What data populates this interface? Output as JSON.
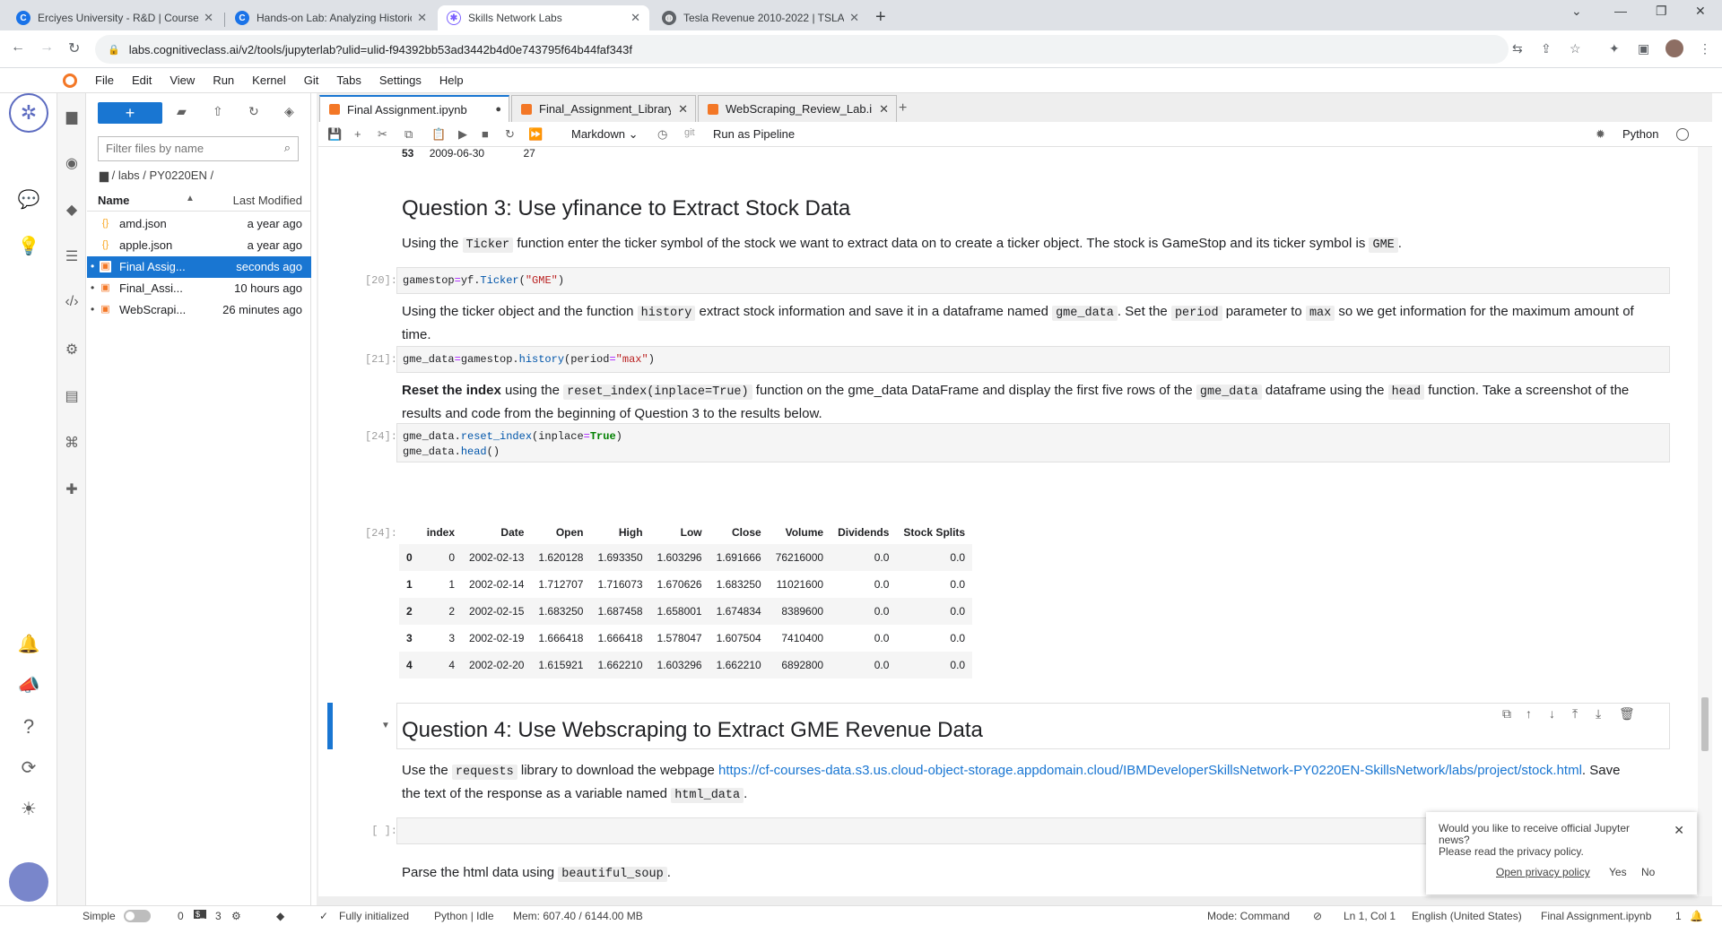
{
  "browser": {
    "tabs": [
      {
        "title": "Erciyes University - R&D | Course",
        "icon": "chrome-icon"
      },
      {
        "title": "Hands-on Lab: Analyzing Historic",
        "icon": "chrome-icon"
      },
      {
        "title": "Skills Network Labs",
        "icon": "skills-network-icon"
      },
      {
        "title": "Tesla Revenue 2010-2022 | TSLA",
        "icon": "globe-icon"
      }
    ],
    "url": "labs.cognitiveclass.ai/v2/tools/jupyterlab?ulid=ulid-f94392bb53ad3442b4d0e743795f64b44faf343f"
  },
  "menu": [
    "File",
    "Edit",
    "View",
    "Run",
    "Kernel",
    "Git",
    "Tabs",
    "Settings",
    "Help"
  ],
  "filebrowser": {
    "filter_placeholder": "Filter files by name",
    "breadcrumb": "/ labs / PY0220EN /",
    "col_name": "Name",
    "col_modified": "Last Modified",
    "files": [
      {
        "name": "amd.json",
        "modified": "a year ago",
        "type": "json",
        "running": false
      },
      {
        "name": "apple.json",
        "modified": "a year ago",
        "type": "json",
        "running": false
      },
      {
        "name": "Final Assig...",
        "modified": "seconds ago",
        "type": "notebook",
        "running": true,
        "selected": true
      },
      {
        "name": "Final_Assi...",
        "modified": "10 hours ago",
        "type": "notebook",
        "running": true
      },
      {
        "name": "WebScrapi...",
        "modified": "26 minutes ago",
        "type": "notebook",
        "running": true
      }
    ]
  },
  "doc_tabs": [
    "Final Assignment.ipynb",
    "Final_Assignment_Library.ip",
    "WebScraping_Review_Lab.ip"
  ],
  "toolbar": {
    "cell_type": "Markdown",
    "git": "git",
    "pipeline": "Run as Pipeline",
    "kernel": "Python"
  },
  "notebook": {
    "prev_row": {
      "idx": "53",
      "date": "2009-06-30",
      "val": "27"
    },
    "q3_title": "Question 3: Use yfinance to Extract Stock Data",
    "q3_p1a": "Using the ",
    "q3_p1_code": "Ticker",
    "q3_p1b": " function enter the ticker symbol of the stock we want to extract data on to create a ticker object. The stock is GameStop and its ticker symbol is ",
    "q3_p1_code2": "GME",
    "q3_p1c": ".",
    "cell20_prompt": "[20]:",
    "cell20_a": "gamestop",
    "cell20_b": "yf",
    "cell20_c": "Ticker",
    "cell20_d": "\"GME\"",
    "q3_p2a": "Using the ticker object and the function ",
    "q3_p2_c1": "history",
    "q3_p2b": " extract stock information and save it in a dataframe named ",
    "q3_p2_c2": "gme_data",
    "q3_p2c": ". Set the ",
    "q3_p2_c3": "period",
    "q3_p2d": " parameter to ",
    "q3_p2_c4": "max",
    "q3_p2e": " so we get information for the maximum amount of time.",
    "cell21_prompt": "[21]:",
    "cell21_a": "gme_data",
    "cell21_b": "gamestop",
    "cell21_c": "history",
    "cell21_d": "period",
    "cell21_e": "\"max\"",
    "q3_p3_bold": "Reset the index",
    "q3_p3a": " using the ",
    "q3_p3_c1": "reset_index(inplace=True)",
    "q3_p3b": " function on the gme_data DataFrame and display the first five rows of the ",
    "q3_p3_c2": "gme_data",
    "q3_p3c": " dataframe using the ",
    "q3_p3_c3": "head",
    "q3_p3d": " function. Take a screenshot of the results and code from the beginning of Question 3 to the results below.",
    "cell24_prompt": "[24]:",
    "cell24_l1a": "gme_data",
    "cell24_l1b": "reset_index",
    "cell24_l1c": "inplace",
    "cell24_l1d": "True",
    "cell24_l2a": "gme_data",
    "cell24_l2b": "head",
    "out24_prompt": "[24]:",
    "table_headers": [
      "",
      "index",
      "Date",
      "Open",
      "High",
      "Low",
      "Close",
      "Volume",
      "Dividends",
      "Stock Splits"
    ],
    "table_rows": [
      [
        "0",
        "0",
        "2002-02-13",
        "1.620128",
        "1.693350",
        "1.603296",
        "1.691666",
        "76216000",
        "0.0",
        "0.0"
      ],
      [
        "1",
        "1",
        "2002-02-14",
        "1.712707",
        "1.716073",
        "1.670626",
        "1.683250",
        "11021600",
        "0.0",
        "0.0"
      ],
      [
        "2",
        "2",
        "2002-02-15",
        "1.683250",
        "1.687458",
        "1.658001",
        "1.674834",
        "8389600",
        "0.0",
        "0.0"
      ],
      [
        "3",
        "3",
        "2002-02-19",
        "1.666418",
        "1.666418",
        "1.578047",
        "1.607504",
        "7410400",
        "0.0",
        "0.0"
      ],
      [
        "4",
        "4",
        "2002-02-20",
        "1.615921",
        "1.662210",
        "1.603296",
        "1.662210",
        "6892800",
        "0.0",
        "0.0"
      ]
    ],
    "q4_title": "Question 4: Use Webscraping to Extract GME Revenue Data",
    "q4_p1a": "Use the ",
    "q4_p1_c1": "requests",
    "q4_p1b": " library to download the webpage ",
    "q4_link": "https://cf-courses-data.s3.us.cloud-object-storage.appdomain.cloud/IBMDeveloperSkillsNetwork-PY0220EN-SkillsNetwork/labs/project/stock.html",
    "q4_p1c": ". Save the text of the response as a variable named ",
    "q4_p1_c2": "html_data",
    "q4_p1d": ".",
    "empty_prompt": "[ ]:",
    "q4_p2a": "Parse the html data using ",
    "q4_p2_c1": "beautiful_soup",
    "q4_p2b": "."
  },
  "popup": {
    "line1": "Would you like to receive official Jupyter news?",
    "line2": "Please read the privacy policy.",
    "link": "Open privacy policy",
    "yes": "Yes",
    "no": "No"
  },
  "status": {
    "mode": "Simple",
    "terminals": "0",
    "kernels": "3",
    "init": "Fully initialized",
    "kernel": "Python | Idle",
    "mem": "Mem: 607.40 / 6144.00 MB",
    "cmd_mode": "Mode: Command",
    "pos": "Ln 1, Col 1",
    "lang": "English (United States)",
    "file": "Final Assignment.ipynb",
    "count": "1"
  }
}
